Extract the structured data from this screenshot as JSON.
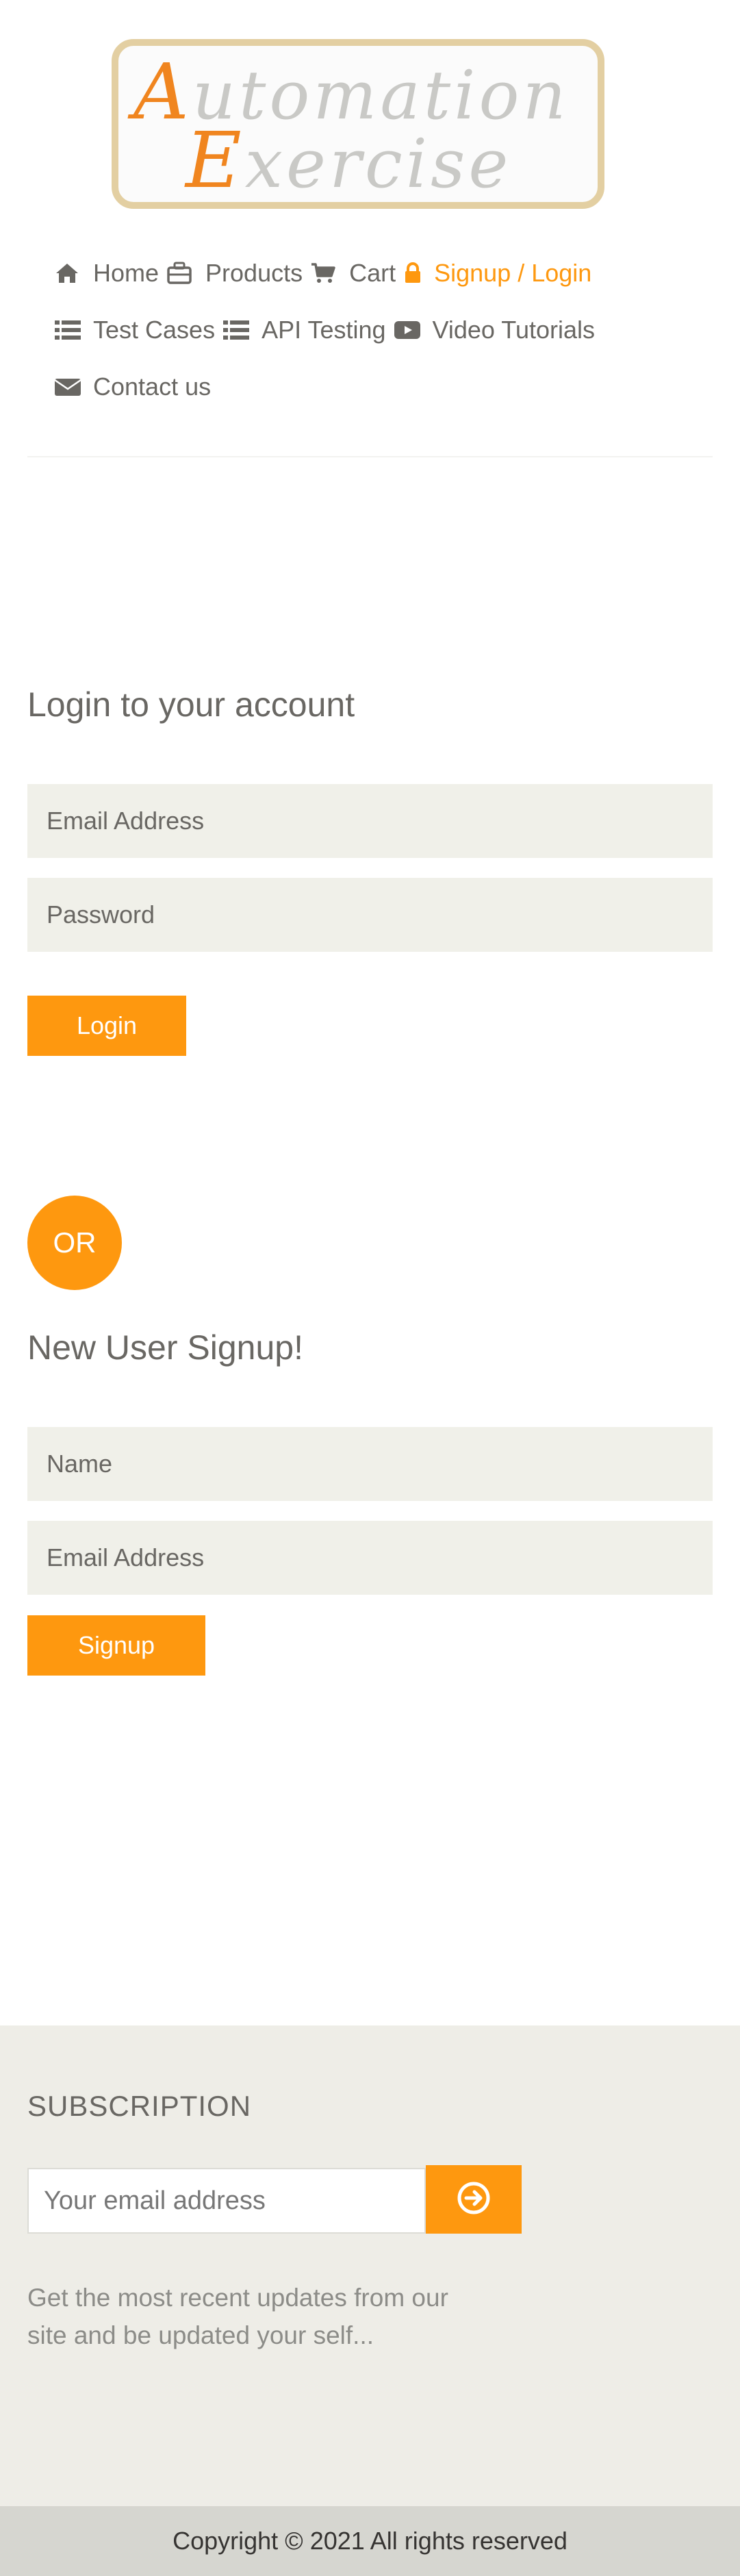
{
  "logo": {
    "line1_cap": "A",
    "line1_rest": "utomation",
    "line2_cap": "E",
    "line2_rest": "xercise"
  },
  "nav": {
    "items": [
      {
        "label": "Home",
        "icon": "home-icon"
      },
      {
        "label": "Products",
        "icon": "briefcase-icon"
      },
      {
        "label": "Cart",
        "icon": "cart-icon"
      },
      {
        "label": "Signup / Login",
        "icon": "lock-icon",
        "active": true
      },
      {
        "label": "Test Cases",
        "icon": "list-icon"
      },
      {
        "label": "API Testing",
        "icon": "list-icon"
      },
      {
        "label": "Video Tutorials",
        "icon": "youtube-play-icon"
      },
      {
        "label": "Contact us",
        "icon": "envelope-icon"
      }
    ]
  },
  "login": {
    "title": "Login to your account",
    "email_placeholder": "Email Address",
    "password_placeholder": "Password",
    "button": "Login"
  },
  "or_label": "OR",
  "signup": {
    "title": "New User Signup!",
    "name_placeholder": "Name",
    "email_placeholder": "Email Address",
    "button": "Signup"
  },
  "footer": {
    "subscription_title": "SUBSCRIPTION",
    "email_placeholder": "Your email address",
    "subscribe_icon": "arrow-circle-right-icon",
    "description": "Get the most recent updates from our site and be updated your self...",
    "copyright": "Copyright © 2021 All rights reserved"
  },
  "colors": {
    "accent": "#FE980F",
    "field_bg": "#F0F0E9",
    "text": "#696763",
    "footer_bg": "#EEEDE7"
  }
}
